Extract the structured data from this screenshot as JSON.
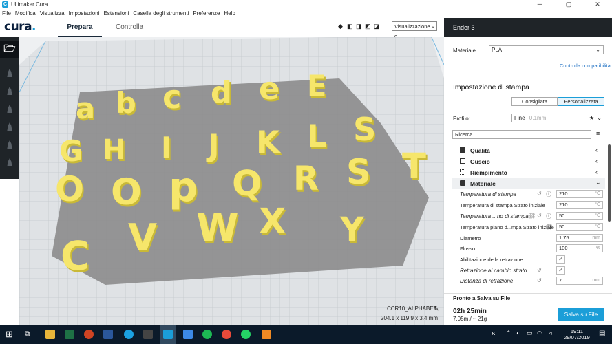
{
  "window": {
    "title": "Ultimaker Cura",
    "minimize": "─",
    "maximize": "▢",
    "close": "✕"
  },
  "menu": [
    "File",
    "Modifica",
    "Visualizza",
    "Impostazioni",
    "Estensioni",
    "Casella degli strumenti",
    "Preferenze",
    "Help"
  ],
  "header": {
    "logo": "cura",
    "tabs": {
      "prepara": "Prepara",
      "controlla": "Controlla"
    },
    "view_select": "Visualizzazione c..."
  },
  "printer": {
    "name": "Ender 3"
  },
  "material": {
    "label": "Materiale",
    "value": "PLA",
    "compat_link": "Controlla compatibilità"
  },
  "print_settings": {
    "title": "Impostazione di stampa",
    "mode_recommended": "Consigliata",
    "mode_custom": "Personalizzata",
    "profile_label": "Profilo:",
    "profile_value": "Fine",
    "profile_hint": "0.1mm",
    "search_placeholder": "Ricerca...",
    "sections": {
      "quality": "Qualità",
      "shell": "Guscio",
      "infill": "Riempimento",
      "material": "Materiale"
    },
    "settings": [
      {
        "label": "Temperatura di stampa",
        "value": "210",
        "unit": "°C"
      },
      {
        "label": "Temperatura di stampa Strato iniziale",
        "value": "210",
        "unit": "°C"
      },
      {
        "label": "Temperatura ...no di stampa",
        "value": "50",
        "unit": "°C"
      },
      {
        "label": "Temperatura piano d...mpa Strato iniziale",
        "value": "50",
        "unit": "°C"
      },
      {
        "label": "Diametro",
        "value": "1.75",
        "unit": "mm"
      },
      {
        "label": "Flusso",
        "value": "100",
        "unit": "%"
      },
      {
        "label": "Abilitazione della retrazione",
        "value": "✓",
        "unit": ""
      },
      {
        "label": "Retrazione al cambio strato",
        "value": "✓",
        "unit": ""
      },
      {
        "label": "Distanza di retrazione",
        "value": "7",
        "unit": "mm"
      }
    ]
  },
  "object": {
    "name": "CCR10_ALPHABET",
    "dimensions": "204.1 x 119.9 x 3.4 mm"
  },
  "save": {
    "status": "Pronto a Salva su File",
    "time": "02h 25min",
    "usage": "7.05m / ~ 21g",
    "button": "Salva su File"
  },
  "letters": [
    "a",
    "b",
    "c",
    "d",
    "e",
    "E",
    "G",
    "H",
    "I",
    "J",
    "K",
    "L",
    "S",
    "O",
    "O",
    "p",
    "Q",
    "R",
    "S",
    "T",
    "C",
    "V",
    "W",
    "X",
    "Y"
  ],
  "clock": {
    "time": "19:11",
    "date": "29/07/2019"
  },
  "colors": {
    "accent": "#1b9ed8",
    "dark": "#1f2428",
    "letter": "#f6e66b",
    "letter_side": "#c9b937",
    "bed": "#8c8c8c"
  }
}
